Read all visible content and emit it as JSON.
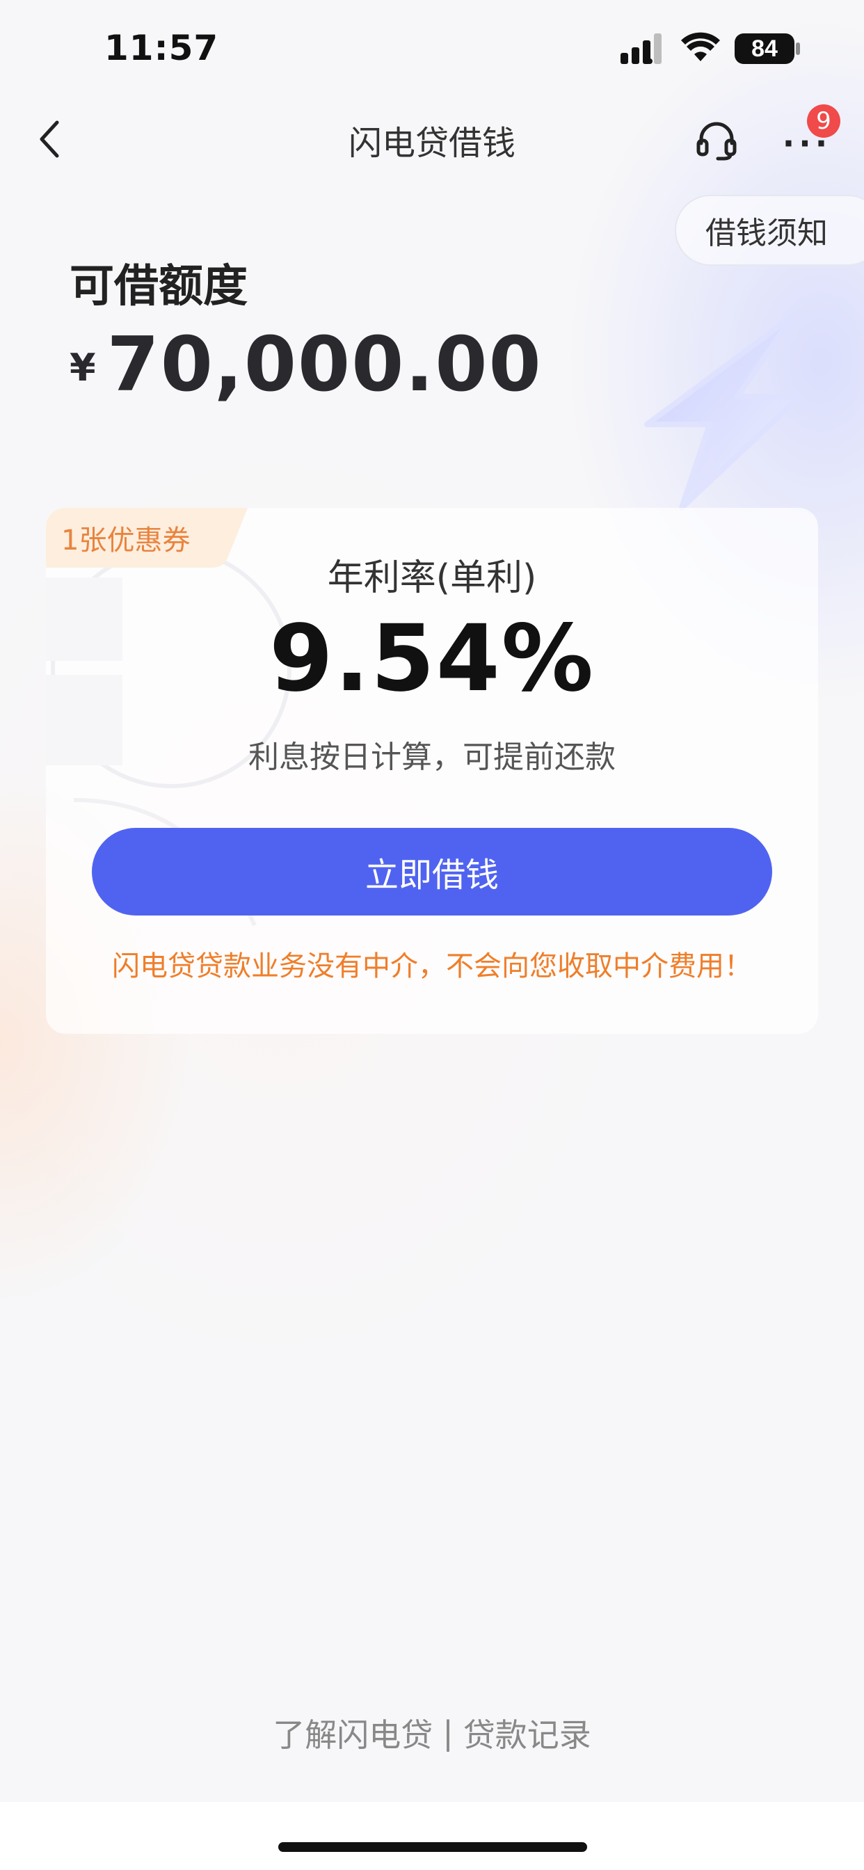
{
  "status_bar": {
    "time": "11:57",
    "battery": "84",
    "signal_icon": "cellular-signal-icon",
    "wifi_icon": "wifi-icon",
    "battery_icon": "battery-icon"
  },
  "nav": {
    "back_icon": "chevron-left-icon",
    "title": "闪电贷借钱",
    "support_icon": "headset-icon",
    "more_label": "···",
    "badge_count": "9"
  },
  "notice": {
    "label": "借钱须知"
  },
  "limit": {
    "label": "可借额度",
    "currency": "¥",
    "amount": "70,000.00"
  },
  "rate_card": {
    "coupon_label": "1张优惠券",
    "rate_label": "年利率(单利)",
    "rate_value": "9.54%",
    "rate_note": "利息按日计算，可提前还款",
    "button_label": "立即借钱",
    "warning": "闪电贷贷款业务没有中介，不会向您收取中介费用！"
  },
  "footer": {
    "link_about": "了解闪电贷",
    "separator": "|",
    "link_records": "贷款记录"
  },
  "colors": {
    "primary_button": "#5063f0",
    "warning": "#ef7e2a",
    "coupon_text": "#e8843e",
    "badge": "#f04a4a"
  }
}
